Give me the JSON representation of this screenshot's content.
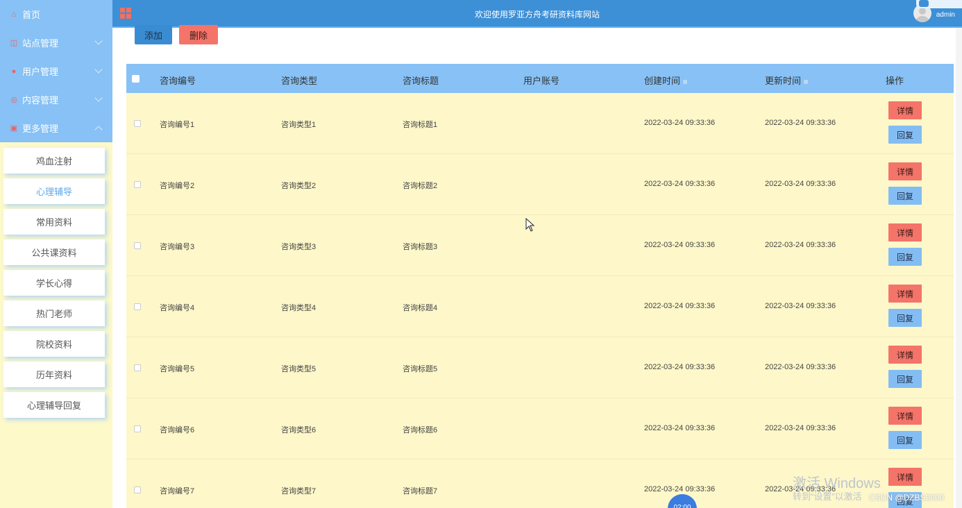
{
  "sidebar": {
    "menu": [
      {
        "label": "首页",
        "icon": "home-icon",
        "chevron": "none"
      },
      {
        "label": "站点管理",
        "icon": "site-icon",
        "chevron": "down"
      },
      {
        "label": "用户管理",
        "icon": "user-icon",
        "chevron": "down"
      },
      {
        "label": "内容管理",
        "icon": "content-icon",
        "chevron": "down"
      },
      {
        "label": "更多管理",
        "icon": "more-icon",
        "chevron": "up"
      }
    ],
    "submenu": [
      {
        "label": "鸡血注射",
        "active": false
      },
      {
        "label": "心理辅导",
        "active": true
      },
      {
        "label": "常用资料",
        "active": false
      },
      {
        "label": "公共课资料",
        "active": false
      },
      {
        "label": "学长心得",
        "active": false
      },
      {
        "label": "热门老师",
        "active": false
      },
      {
        "label": "院校资料",
        "active": false
      },
      {
        "label": "历年资料",
        "active": false
      },
      {
        "label": "心理辅导回复",
        "active": false
      }
    ]
  },
  "header": {
    "title": "欢迎使用罗亚方舟考研资料库网站",
    "username": "admin"
  },
  "toolbar": {
    "add_label": "添加",
    "delete_label": "删除"
  },
  "table": {
    "columns": [
      "咨询编号",
      "咨询类型",
      "咨询标题",
      "用户账号",
      "创建时间",
      "更新时间",
      "操作"
    ],
    "detail_label": "详情",
    "reply_label": "回复",
    "rows": [
      {
        "no": "咨询编号1",
        "type": "咨询类型1",
        "title": "咨询标题1",
        "account": "",
        "created": "2022-03-24 09:33:36",
        "updated": "2022-03-24 09:33:36"
      },
      {
        "no": "咨询编号2",
        "type": "咨询类型2",
        "title": "咨询标题2",
        "account": "",
        "created": "2022-03-24 09:33:36",
        "updated": "2022-03-24 09:33:36"
      },
      {
        "no": "咨询编号3",
        "type": "咨询类型3",
        "title": "咨询标题3",
        "account": "",
        "created": "2022-03-24 09:33:36",
        "updated": "2022-03-24 09:33:36"
      },
      {
        "no": "咨询编号4",
        "type": "咨询类型4",
        "title": "咨询标题4",
        "account": "",
        "created": "2022-03-24 09:33:36",
        "updated": "2022-03-24 09:33:36"
      },
      {
        "no": "咨询编号5",
        "type": "咨询类型5",
        "title": "咨询标题5",
        "account": "",
        "created": "2022-03-24 09:33:36",
        "updated": "2022-03-24 09:33:36"
      },
      {
        "no": "咨询编号6",
        "type": "咨询类型6",
        "title": "咨询标题6",
        "account": "",
        "created": "2022-03-24 09:33:36",
        "updated": "2022-03-24 09:33:36"
      },
      {
        "no": "咨询编号7",
        "type": "咨询类型7",
        "title": "咨询标题7",
        "account": "",
        "created": "2022-03-24 09:33:36",
        "updated": "2022-03-24 09:33:36"
      }
    ]
  },
  "overlay": {
    "watermark_line1": "激活 Windows",
    "watermark_line2": "转到“设置”以激活",
    "csdn_credit": "CSDN @DZBS2000",
    "timer": "02:00"
  },
  "colors": {
    "sidebar_menu": "#87c1f5",
    "header": "#3d8fd6",
    "row_bg": "#fdf7c9",
    "danger": "#f4746a",
    "info": "#84bdf3"
  }
}
